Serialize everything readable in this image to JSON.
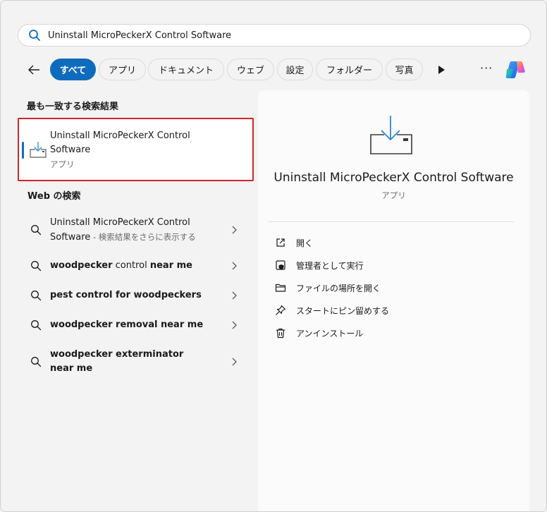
{
  "search": {
    "query": "Uninstall MicroPeckerX Control Software",
    "icon": "search-icon"
  },
  "filters": {
    "items": [
      {
        "label": "すべて",
        "active": true
      },
      {
        "label": "アプリ",
        "active": false
      },
      {
        "label": "ドキュメント",
        "active": false
      },
      {
        "label": "ウェブ",
        "active": false
      },
      {
        "label": "設定",
        "active": false
      },
      {
        "label": "フォルダー",
        "active": false
      },
      {
        "label": "写真",
        "active": false
      }
    ],
    "more_label": "···"
  },
  "best_match": {
    "heading": "最も一致する検索結果",
    "title": "Uninstall MicroPeckerX Control Software",
    "type": "アプリ"
  },
  "web": {
    "heading": "Web の検索",
    "items": [
      {
        "bold": "",
        "plain": "Uninstall MicroPeckerX Control Software",
        "hint": " - 検索結果をさらに表示する"
      },
      {
        "bold": "woodpecker",
        "plain": " control ",
        "bold2": "near me",
        "hint": ""
      },
      {
        "bold": "pest control for woodpeckers",
        "plain": "",
        "hint": ""
      },
      {
        "bold": "woodpecker removal near me",
        "plain": "",
        "hint": ""
      },
      {
        "bold": "woodpecker exterminator near me",
        "plain": "",
        "hint": ""
      }
    ]
  },
  "detail": {
    "app_name": "Uninstall MicroPeckerX Control Software",
    "app_type": "アプリ",
    "actions": [
      {
        "label": "開く",
        "icon": "open-icon"
      },
      {
        "label": "管理者として実行",
        "icon": "shield-icon"
      },
      {
        "label": "ファイルの場所を開く",
        "icon": "folder-icon"
      },
      {
        "label": "スタートにピン留めする",
        "icon": "pin-icon"
      },
      {
        "label": "アンインストール",
        "icon": "trash-icon"
      }
    ]
  },
  "colors": {
    "accent": "#0f6cbd",
    "highlight_border": "#d0242b"
  }
}
